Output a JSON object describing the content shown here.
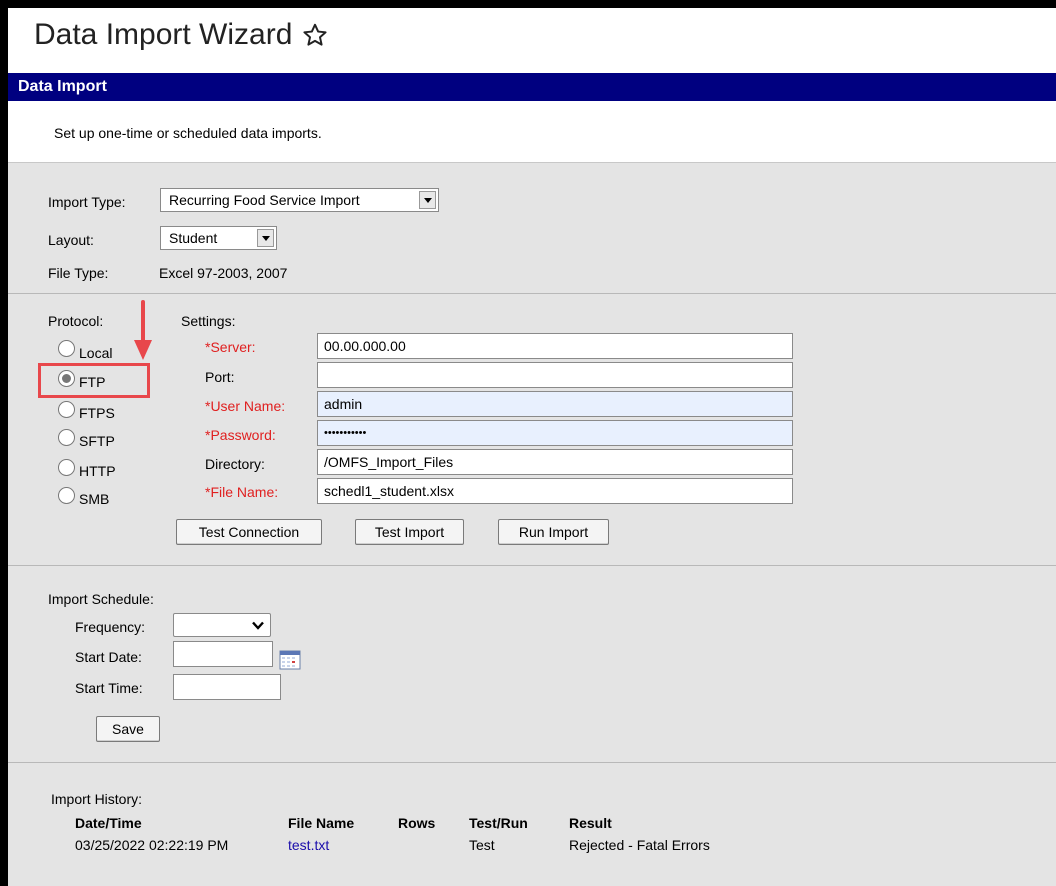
{
  "page": {
    "title": "Data Import Wizard",
    "section_header": "Data Import",
    "subtitle": "Set up one-time or scheduled data imports."
  },
  "import_type": {
    "label": "Import Type:",
    "value": "Recurring Food Service Import"
  },
  "layout": {
    "label": "Layout:",
    "value": "Student"
  },
  "file_type": {
    "label": "File Type:",
    "value": "Excel 97-2003, 2007"
  },
  "protocol": {
    "label": "Protocol:",
    "options": [
      "Local",
      "FTP",
      "FTPS",
      "SFTP",
      "HTTP",
      "SMB"
    ],
    "selected": "FTP"
  },
  "settings": {
    "label": "Settings:",
    "server_label": "*Server:",
    "server": "00.00.000.00",
    "port_label": "Port:",
    "port": "",
    "user_label": "*User Name:",
    "user": "admin",
    "password_label": "*Password:",
    "password": "•••••••••••",
    "directory_label": "Directory:",
    "directory": "/OMFS_Import_Files",
    "filename_label": "*File Name:",
    "filename": "schedl1_student.xlsx"
  },
  "buttons": {
    "test_connection": "Test Connection",
    "test_import": "Test Import",
    "run_import": "Run Import",
    "save": "Save"
  },
  "schedule": {
    "label": "Import Schedule:",
    "frequency_label": "Frequency:",
    "frequency": "",
    "start_date_label": "Start Date:",
    "start_date": "",
    "start_time_label": "Start Time:",
    "start_time": ""
  },
  "history": {
    "label": "Import History:",
    "columns": [
      "Date/Time",
      "File Name",
      "Rows",
      "Test/Run",
      "Result"
    ],
    "rows": [
      {
        "datetime": "03/25/2022 02:22:19 PM",
        "file": "test.txt",
        "rows": "",
        "test_run": "Test",
        "result": "Rejected - Fatal Errors"
      }
    ]
  },
  "colors": {
    "header_bg": "#000080",
    "required": "#e02020",
    "annotation": "#e8474b",
    "link": "#1a0dab"
  }
}
